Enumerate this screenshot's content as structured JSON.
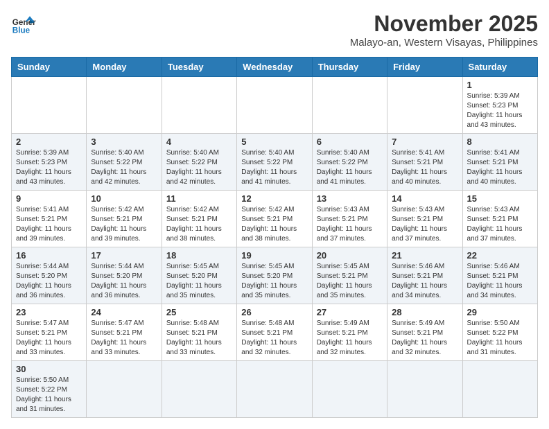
{
  "logo": {
    "text_general": "General",
    "text_blue": "Blue"
  },
  "header": {
    "month": "November 2025",
    "location": "Malayo-an, Western Visayas, Philippines"
  },
  "days_of_week": [
    "Sunday",
    "Monday",
    "Tuesday",
    "Wednesday",
    "Thursday",
    "Friday",
    "Saturday"
  ],
  "weeks": [
    [
      {
        "day": "",
        "sunrise": "",
        "sunset": "",
        "daylight": ""
      },
      {
        "day": "",
        "sunrise": "",
        "sunset": "",
        "daylight": ""
      },
      {
        "day": "",
        "sunrise": "",
        "sunset": "",
        "daylight": ""
      },
      {
        "day": "",
        "sunrise": "",
        "sunset": "",
        "daylight": ""
      },
      {
        "day": "",
        "sunrise": "",
        "sunset": "",
        "daylight": ""
      },
      {
        "day": "",
        "sunrise": "",
        "sunset": "",
        "daylight": ""
      },
      {
        "day": "1",
        "sunrise": "Sunrise: 5:39 AM",
        "sunset": "Sunset: 5:23 PM",
        "daylight": "Daylight: 11 hours and 43 minutes."
      }
    ],
    [
      {
        "day": "2",
        "sunrise": "Sunrise: 5:39 AM",
        "sunset": "Sunset: 5:23 PM",
        "daylight": "Daylight: 11 hours and 43 minutes."
      },
      {
        "day": "3",
        "sunrise": "Sunrise: 5:40 AM",
        "sunset": "Sunset: 5:22 PM",
        "daylight": "Daylight: 11 hours and 42 minutes."
      },
      {
        "day": "4",
        "sunrise": "Sunrise: 5:40 AM",
        "sunset": "Sunset: 5:22 PM",
        "daylight": "Daylight: 11 hours and 42 minutes."
      },
      {
        "day": "5",
        "sunrise": "Sunrise: 5:40 AM",
        "sunset": "Sunset: 5:22 PM",
        "daylight": "Daylight: 11 hours and 41 minutes."
      },
      {
        "day": "6",
        "sunrise": "Sunrise: 5:40 AM",
        "sunset": "Sunset: 5:22 PM",
        "daylight": "Daylight: 11 hours and 41 minutes."
      },
      {
        "day": "7",
        "sunrise": "Sunrise: 5:41 AM",
        "sunset": "Sunset: 5:21 PM",
        "daylight": "Daylight: 11 hours and 40 minutes."
      },
      {
        "day": "8",
        "sunrise": "Sunrise: 5:41 AM",
        "sunset": "Sunset: 5:21 PM",
        "daylight": "Daylight: 11 hours and 40 minutes."
      }
    ],
    [
      {
        "day": "9",
        "sunrise": "Sunrise: 5:41 AM",
        "sunset": "Sunset: 5:21 PM",
        "daylight": "Daylight: 11 hours and 39 minutes."
      },
      {
        "day": "10",
        "sunrise": "Sunrise: 5:42 AM",
        "sunset": "Sunset: 5:21 PM",
        "daylight": "Daylight: 11 hours and 39 minutes."
      },
      {
        "day": "11",
        "sunrise": "Sunrise: 5:42 AM",
        "sunset": "Sunset: 5:21 PM",
        "daylight": "Daylight: 11 hours and 38 minutes."
      },
      {
        "day": "12",
        "sunrise": "Sunrise: 5:42 AM",
        "sunset": "Sunset: 5:21 PM",
        "daylight": "Daylight: 11 hours and 38 minutes."
      },
      {
        "day": "13",
        "sunrise": "Sunrise: 5:43 AM",
        "sunset": "Sunset: 5:21 PM",
        "daylight": "Daylight: 11 hours and 37 minutes."
      },
      {
        "day": "14",
        "sunrise": "Sunrise: 5:43 AM",
        "sunset": "Sunset: 5:21 PM",
        "daylight": "Daylight: 11 hours and 37 minutes."
      },
      {
        "day": "15",
        "sunrise": "Sunrise: 5:43 AM",
        "sunset": "Sunset: 5:21 PM",
        "daylight": "Daylight: 11 hours and 37 minutes."
      }
    ],
    [
      {
        "day": "16",
        "sunrise": "Sunrise: 5:44 AM",
        "sunset": "Sunset: 5:20 PM",
        "daylight": "Daylight: 11 hours and 36 minutes."
      },
      {
        "day": "17",
        "sunrise": "Sunrise: 5:44 AM",
        "sunset": "Sunset: 5:20 PM",
        "daylight": "Daylight: 11 hours and 36 minutes."
      },
      {
        "day": "18",
        "sunrise": "Sunrise: 5:45 AM",
        "sunset": "Sunset: 5:20 PM",
        "daylight": "Daylight: 11 hours and 35 minutes."
      },
      {
        "day": "19",
        "sunrise": "Sunrise: 5:45 AM",
        "sunset": "Sunset: 5:20 PM",
        "daylight": "Daylight: 11 hours and 35 minutes."
      },
      {
        "day": "20",
        "sunrise": "Sunrise: 5:45 AM",
        "sunset": "Sunset: 5:21 PM",
        "daylight": "Daylight: 11 hours and 35 minutes."
      },
      {
        "day": "21",
        "sunrise": "Sunrise: 5:46 AM",
        "sunset": "Sunset: 5:21 PM",
        "daylight": "Daylight: 11 hours and 34 minutes."
      },
      {
        "day": "22",
        "sunrise": "Sunrise: 5:46 AM",
        "sunset": "Sunset: 5:21 PM",
        "daylight": "Daylight: 11 hours and 34 minutes."
      }
    ],
    [
      {
        "day": "23",
        "sunrise": "Sunrise: 5:47 AM",
        "sunset": "Sunset: 5:21 PM",
        "daylight": "Daylight: 11 hours and 33 minutes."
      },
      {
        "day": "24",
        "sunrise": "Sunrise: 5:47 AM",
        "sunset": "Sunset: 5:21 PM",
        "daylight": "Daylight: 11 hours and 33 minutes."
      },
      {
        "day": "25",
        "sunrise": "Sunrise: 5:48 AM",
        "sunset": "Sunset: 5:21 PM",
        "daylight": "Daylight: 11 hours and 33 minutes."
      },
      {
        "day": "26",
        "sunrise": "Sunrise: 5:48 AM",
        "sunset": "Sunset: 5:21 PM",
        "daylight": "Daylight: 11 hours and 32 minutes."
      },
      {
        "day": "27",
        "sunrise": "Sunrise: 5:49 AM",
        "sunset": "Sunset: 5:21 PM",
        "daylight": "Daylight: 11 hours and 32 minutes."
      },
      {
        "day": "28",
        "sunrise": "Sunrise: 5:49 AM",
        "sunset": "Sunset: 5:21 PM",
        "daylight": "Daylight: 11 hours and 32 minutes."
      },
      {
        "day": "29",
        "sunrise": "Sunrise: 5:50 AM",
        "sunset": "Sunset: 5:22 PM",
        "daylight": "Daylight: 11 hours and 31 minutes."
      }
    ],
    [
      {
        "day": "30",
        "sunrise": "Sunrise: 5:50 AM",
        "sunset": "Sunset: 5:22 PM",
        "daylight": "Daylight: 11 hours and 31 minutes."
      },
      {
        "day": "",
        "sunrise": "",
        "sunset": "",
        "daylight": ""
      },
      {
        "day": "",
        "sunrise": "",
        "sunset": "",
        "daylight": ""
      },
      {
        "day": "",
        "sunrise": "",
        "sunset": "",
        "daylight": ""
      },
      {
        "day": "",
        "sunrise": "",
        "sunset": "",
        "daylight": ""
      },
      {
        "day": "",
        "sunrise": "",
        "sunset": "",
        "daylight": ""
      },
      {
        "day": "",
        "sunrise": "",
        "sunset": "",
        "daylight": ""
      }
    ]
  ]
}
